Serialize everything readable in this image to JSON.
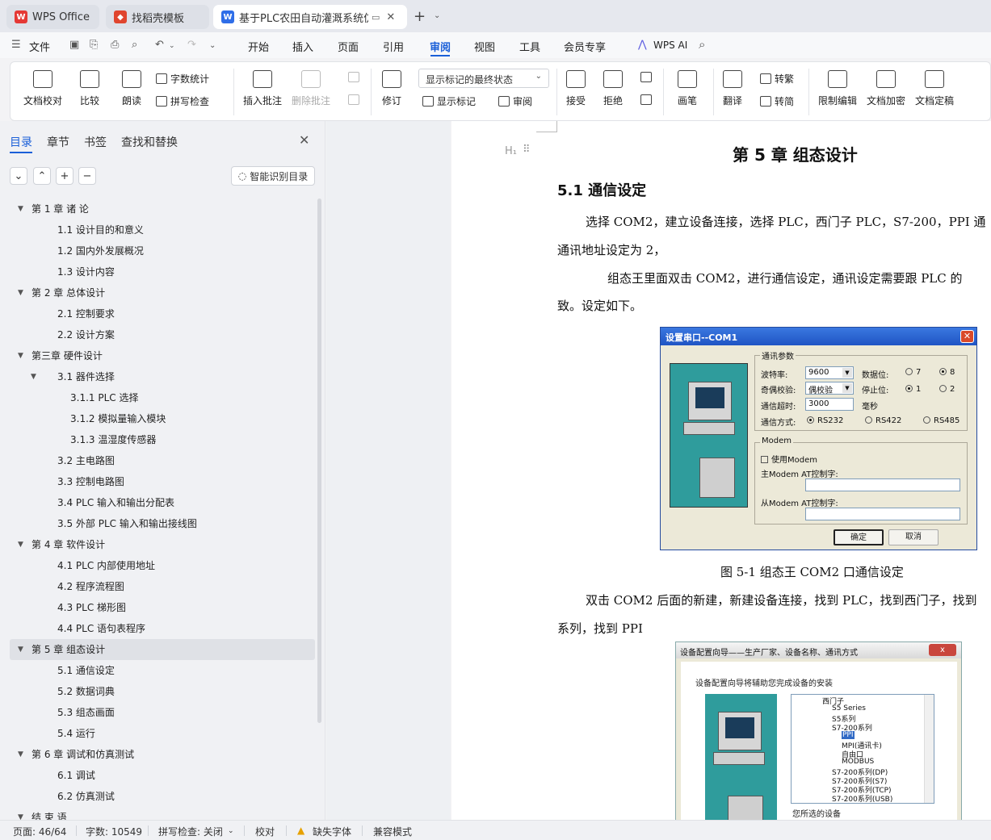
{
  "tabs": [
    {
      "label": "WPS Office",
      "icon": "wps-logo-icon"
    },
    {
      "label": "找稻壳模板",
      "icon": "docer-logo-icon"
    },
    {
      "label": "基于PLC农田自动灌溉系统仿真",
      "icon": "writer-doc-icon"
    }
  ],
  "menu": {
    "file": "文件",
    "items": [
      "开始",
      "插入",
      "页面",
      "引用",
      "审阅",
      "视图",
      "工具",
      "会员专享"
    ],
    "active": "审阅",
    "ai": "WPS AI"
  },
  "ribbon": {
    "doc_check": "文档校对",
    "compare": "比较",
    "read_aloud": "朗读",
    "word_count": "字数统计",
    "spell_check": "拼写检查",
    "insert_comment": "插入批注",
    "delete_comment": "删除批注",
    "track_changes": "修订",
    "markup_state": "显示标记的最终状态",
    "show_markup": "显示标记",
    "review": "审阅",
    "accept": "接受",
    "reject": "拒绝",
    "ink": "画笔",
    "translate": "翻译",
    "to_traditional": "转繁",
    "to_simplified": "转简",
    "restrict_edit": "限制编辑",
    "encrypt": "文档加密",
    "finalize": "文档定稿"
  },
  "nav": {
    "tabs": [
      "目录",
      "章节",
      "书签",
      "查找和替换"
    ],
    "active": "目录",
    "smart_toc": "智能识别目录",
    "toc": [
      {
        "label": "第 1 章  诸  论",
        "level": 0,
        "toggle": true
      },
      {
        "label": "1.1  设计目的和意义",
        "level": 1
      },
      {
        "label": "1.2  国内外发展概况",
        "level": 1
      },
      {
        "label": "1.3  设计内容",
        "level": 1
      },
      {
        "label": "第 2 章  总体设计",
        "level": 0,
        "toggle": true
      },
      {
        "label": "2.1  控制要求",
        "level": 1
      },
      {
        "label": "2.2    设计方案",
        "level": 1
      },
      {
        "label": "第三章  硬件设计",
        "level": 0,
        "toggle": true
      },
      {
        "label": "3.1 器件选择",
        "level": 1,
        "toggle": true
      },
      {
        "label": "3.1.1 PLC 选择",
        "level": 2
      },
      {
        "label": "3.1.2  模拟量输入模块",
        "level": 2
      },
      {
        "label": "3.1.3  温湿度传感器",
        "level": 2
      },
      {
        "label": "3.2 主电路图",
        "level": 1
      },
      {
        "label": "3.3 控制电路图",
        "level": 1
      },
      {
        "label": "3.4 PLC 输入和输出分配表",
        "level": 1
      },
      {
        "label": "3.5  外部 PLC 输入和输出接线图",
        "level": 1
      },
      {
        "label": "第 4 章  软件设计",
        "level": 0,
        "toggle": true
      },
      {
        "label": "4.1 PLC 内部使用地址",
        "level": 1
      },
      {
        "label": "4.2  程序流程图",
        "level": 1
      },
      {
        "label": "4.3 PLC 梯形图",
        "level": 1
      },
      {
        "label": "4.4 PLC 语句表程序",
        "level": 1
      },
      {
        "label": "第 5 章  组态设计",
        "level": 0,
        "toggle": true,
        "selected": true
      },
      {
        "label": "5.1  通信设定",
        "level": 1
      },
      {
        "label": "5.2 数据词典",
        "level": 1
      },
      {
        "label": "5.3 组态画面",
        "level": 1
      },
      {
        "label": "5.4 运行",
        "level": 1
      },
      {
        "label": "第 6 章  调试和仿真测试",
        "level": 0,
        "toggle": true
      },
      {
        "label": "6.1  调试",
        "level": 1
      },
      {
        "label": "6.2  仿真测试",
        "level": 1
      },
      {
        "label": "结  束  语",
        "level": 0,
        "toggle": true
      }
    ]
  },
  "doc": {
    "chapter_title": "第 5 章  组态设计",
    "section_title": "5.1  通信设定",
    "p1_line1": "选择 COM2，建立设备连接，选择 PLC，西门子 PLC，S7-200，PPI 通",
    "p1_line2": "通讯地址设定为 2，",
    "p2_line1": "组态王里面双击 COM2，进行通信设定，通讯设定需要跟 PLC 的",
    "p2_line2": "致。设定如下。",
    "caption1": "图 5-1  组态王 COM2 口通信设定",
    "p3_line1": "双击 COM2 后面的新建，新建设备连接，找到 PLC，找到西门子，找到",
    "p3_line2": "系列，找到 PPI"
  },
  "dialog1": {
    "title": "设置串口--COM1",
    "group_comm": "通讯参数",
    "baud_label": "波特率:",
    "baud_value": "9600",
    "parity_label": "奇偶校验:",
    "parity_value": "偶校验",
    "timeout_label": "通信超时:",
    "timeout_value": "3000",
    "timeout_unit": "毫秒",
    "databits_label": "数据位:",
    "databits_opts": [
      "7",
      "8"
    ],
    "stopbits_label": "停止位:",
    "stopbits_opts": [
      "1",
      "2"
    ],
    "mode_label": "通信方式:",
    "mode_opts": [
      "RS232",
      "RS422",
      "RS485"
    ],
    "group_modem": "Modem",
    "use_modem": "使用Modem",
    "master_at": "主Modem  AT控制字:",
    "slave_at": "从Modem  AT控制字:",
    "ok": "确定",
    "cancel": "取消"
  },
  "dialog2": {
    "title": "设备配置向导——生产厂家、设备名称、通讯方式",
    "close": "x",
    "message": "设备配置向导将辅助您完成设备的安装",
    "tree": [
      "西门子",
      "S5 Series",
      "S5系列",
      "S7-200系列",
      "PPI",
      "MPI(通讯卡)",
      "自由口",
      "MODBUS",
      "S7-200系列(DP)",
      "S7-200系列(S7)",
      "S7-200系列(TCP)",
      "S7-200系列(USB)"
    ],
    "selected_label": "您所选的设备"
  },
  "status": {
    "page": "页面: 46/64",
    "words": "字数: 10549",
    "spell": "拼写检查: 关闭",
    "proof": "校对",
    "missing_font": "缺失字体",
    "compat": "兼容模式"
  }
}
